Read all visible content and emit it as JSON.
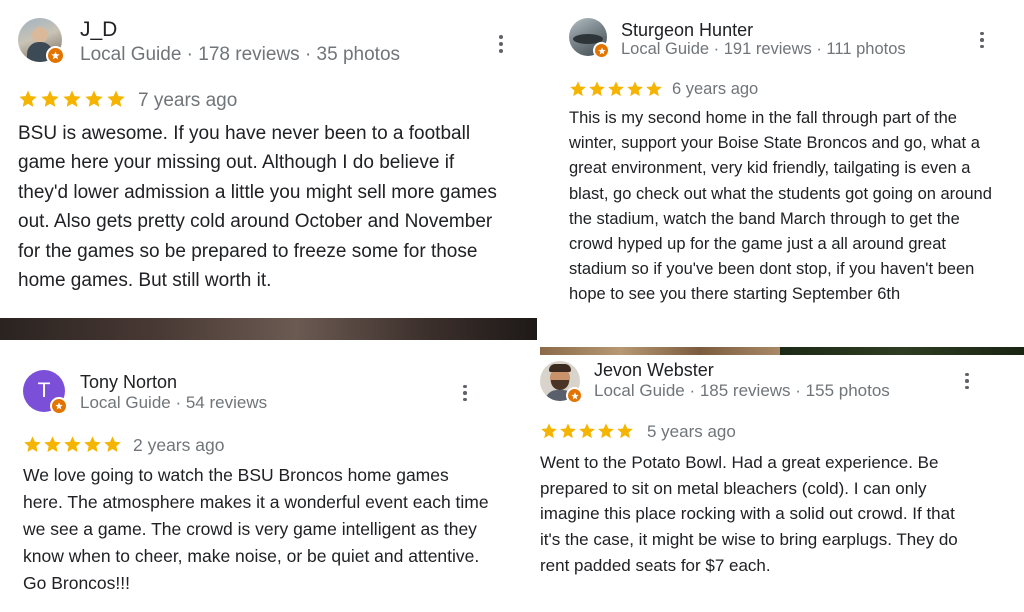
{
  "colors": {
    "star": "#f4b400",
    "badge": "#e37400",
    "name": "#202124",
    "meta": "#70757a",
    "avatar_purple": "#7b4fd8"
  },
  "reviews": [
    {
      "name": "J_D",
      "meta": "Local Guide · 178 reviews · 35 photos",
      "rating": 5,
      "ago": "7 years ago",
      "text": "BSU is awesome. If you have never been to a football game here your missing out. Although I do believe if they'd lower admission a little you might sell more games out. Also gets pretty cold around October and November for the games so be prepared to freeze some for those home games. But still worth it."
    },
    {
      "name": "Sturgeon Hunter",
      "meta": "Local Guide · 191 reviews · 111 photos",
      "rating": 5,
      "ago": "6 years ago",
      "text": "This is my second home in the fall through part of the winter, support your Boise State Broncos and go, what a great environment, very kid friendly, tailgating is even a blast, go check out what the students got going on around the stadium, watch the band March through to get the crowd hyped up for the game just a all around great stadium so if you've been dont stop, if you haven't been hope to see you there starting September 6th"
    },
    {
      "name": "Tony Norton",
      "avatar_letter": "T",
      "meta": "Local Guide · 54 reviews",
      "rating": 5,
      "ago": "2 years ago",
      "text": "We love going to watch the BSU Broncos home games here. The atmosphere makes it a wonderful event each time we see a game. The crowd is very game intelligent as they know when to cheer, make noise, or be quiet and attentive. Go Broncos!!!"
    },
    {
      "name": "Jevon Webster",
      "meta": "Local Guide · 185 reviews · 155 photos",
      "rating": 5,
      "ago": "5 years ago",
      "text": "Went to the Potato Bowl. Had a great experience. Be prepared to sit on metal bleachers (cold). I can only imagine this place rocking with a solid out crowd. If that it's the case, it might be wise to bring earplugs. They do rent padded seats for $7 each."
    }
  ]
}
